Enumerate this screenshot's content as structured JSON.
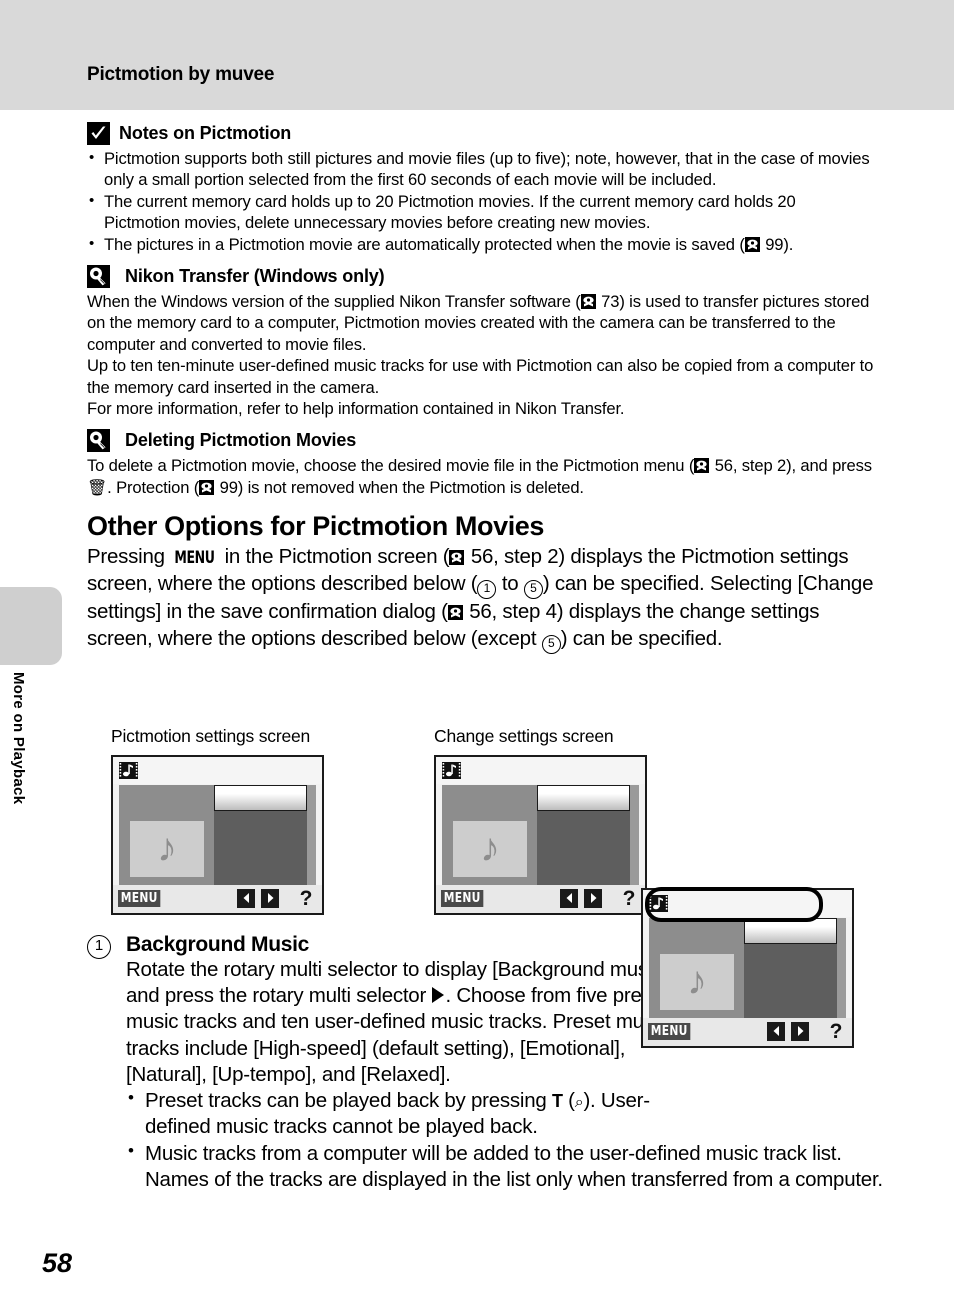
{
  "header": {
    "title": "Pictmotion by muvee"
  },
  "side_tab": {
    "label": "More on Playback"
  },
  "page_number": "58",
  "notes": {
    "icon": "check-square-icon",
    "title": "Notes on Pictmotion",
    "bullets": [
      "Pictmotion supports both still pictures and movie files (up to five); note, however, that in the case of movies only a small portion selected from the first 60 seconds of each movie will be included.",
      "The current memory card holds up to 20 Pictmotion movies. If the current memory card holds 20 Pictmotion movies, delete unnecessary movies before creating new movies.",
      "The pictures in a Pictmotion movie are automatically protected when the movie is saved ( 99)."
    ],
    "bullet3_prefix": "The pictures in a Pictmotion movie are automatically protected when the movie is saved",
    "bullet3_ref": "99)."
  },
  "nikon_transfer": {
    "icon": "lightbulb-square-icon",
    "title": "Nikon Transfer (Windows only)",
    "para1_a": "When the Windows version of the supplied Nikon Transfer software (",
    "para1_ref": "73",
    "para1_b": ") is used to transfer pictures stored on the memory card to a computer, Pictmotion movies created with the camera can be transferred to the computer and converted to movie files.",
    "para2": "Up to ten ten-minute user-defined music tracks for use with Pictmotion can also be copied from a computer to the memory card inserted in the camera.",
    "para3": "For more information, refer to help information contained in Nikon Transfer."
  },
  "deleting": {
    "icon": "lightbulb-square-icon",
    "title": "Deleting Pictmotion Movies",
    "para_a": "To delete a Pictmotion movie, choose the desired movie file in the Pictmotion menu (",
    "ref1": "56",
    "para_b": ", step 2), and press ",
    "trash_glyph": "🗑",
    "para_c": ". Protection (",
    "ref2": "99",
    "para_d": ") is not removed when the Pictmotion is deleted."
  },
  "section": {
    "title": "Other Options for Pictmotion Movies",
    "p_a": "Pressing ",
    "menu_glyph": "MENU",
    "p_b": " in the Pictmotion screen (",
    "ref1": "56",
    "p_c": ", step 2) displays the Pictmotion settings screen, where the options described below (",
    "circ1": "1",
    "p_d": " to ",
    "circ5": "5",
    "p_e": ") can be specified. Selecting [Change settings] in the save confirmation dialog (",
    "ref2": "56",
    "p_f": ", step 4) displays the change settings screen, where the options described below (except ",
    "circ5b": "5",
    "p_g": ") can be specified."
  },
  "screens": {
    "left_caption": "Pictmotion settings screen",
    "right_caption": "Change settings screen",
    "menu_label": "MENU",
    "help_label": "?",
    "left_arrow": "left-arrow-icon",
    "right_arrow": "right-arrow-icon",
    "film_icon": "film-music-icon",
    "note_glyph": "♪"
  },
  "background_music": {
    "number": "1",
    "title": "Background Music",
    "body_a": "Rotate the rotary multi selector to display [Background music] and press the rotary multi selector ",
    "body_b": ". Choose from five preset music tracks and ten user-defined music tracks. Preset music tracks  include [High-speed] (default  setting), [Emotional], [Natural], [Up-tempo], and [Relaxed].",
    "bullet1_a": "Preset tracks can be played back by pressing ",
    "bullet1_t": "T",
    "bullet1_b": " (",
    "bullet1_mag": "⌕",
    "bullet1_c": "). User-defined music tracks cannot be played back.",
    "bullet2": "Music tracks from a computer will be added to the user-defined music track list. Names of the tracks are displayed in the list only when transferred from a computer."
  },
  "colors": {
    "header_band": "#d9d9d9",
    "side_tab": "#cfcfcf",
    "screen_body": "#8d8d8d",
    "screen_right_pane": "#5e5e5e",
    "screen_thumb": "#cdcdcd",
    "screen_bottom_bar": "#e8e8e8"
  }
}
